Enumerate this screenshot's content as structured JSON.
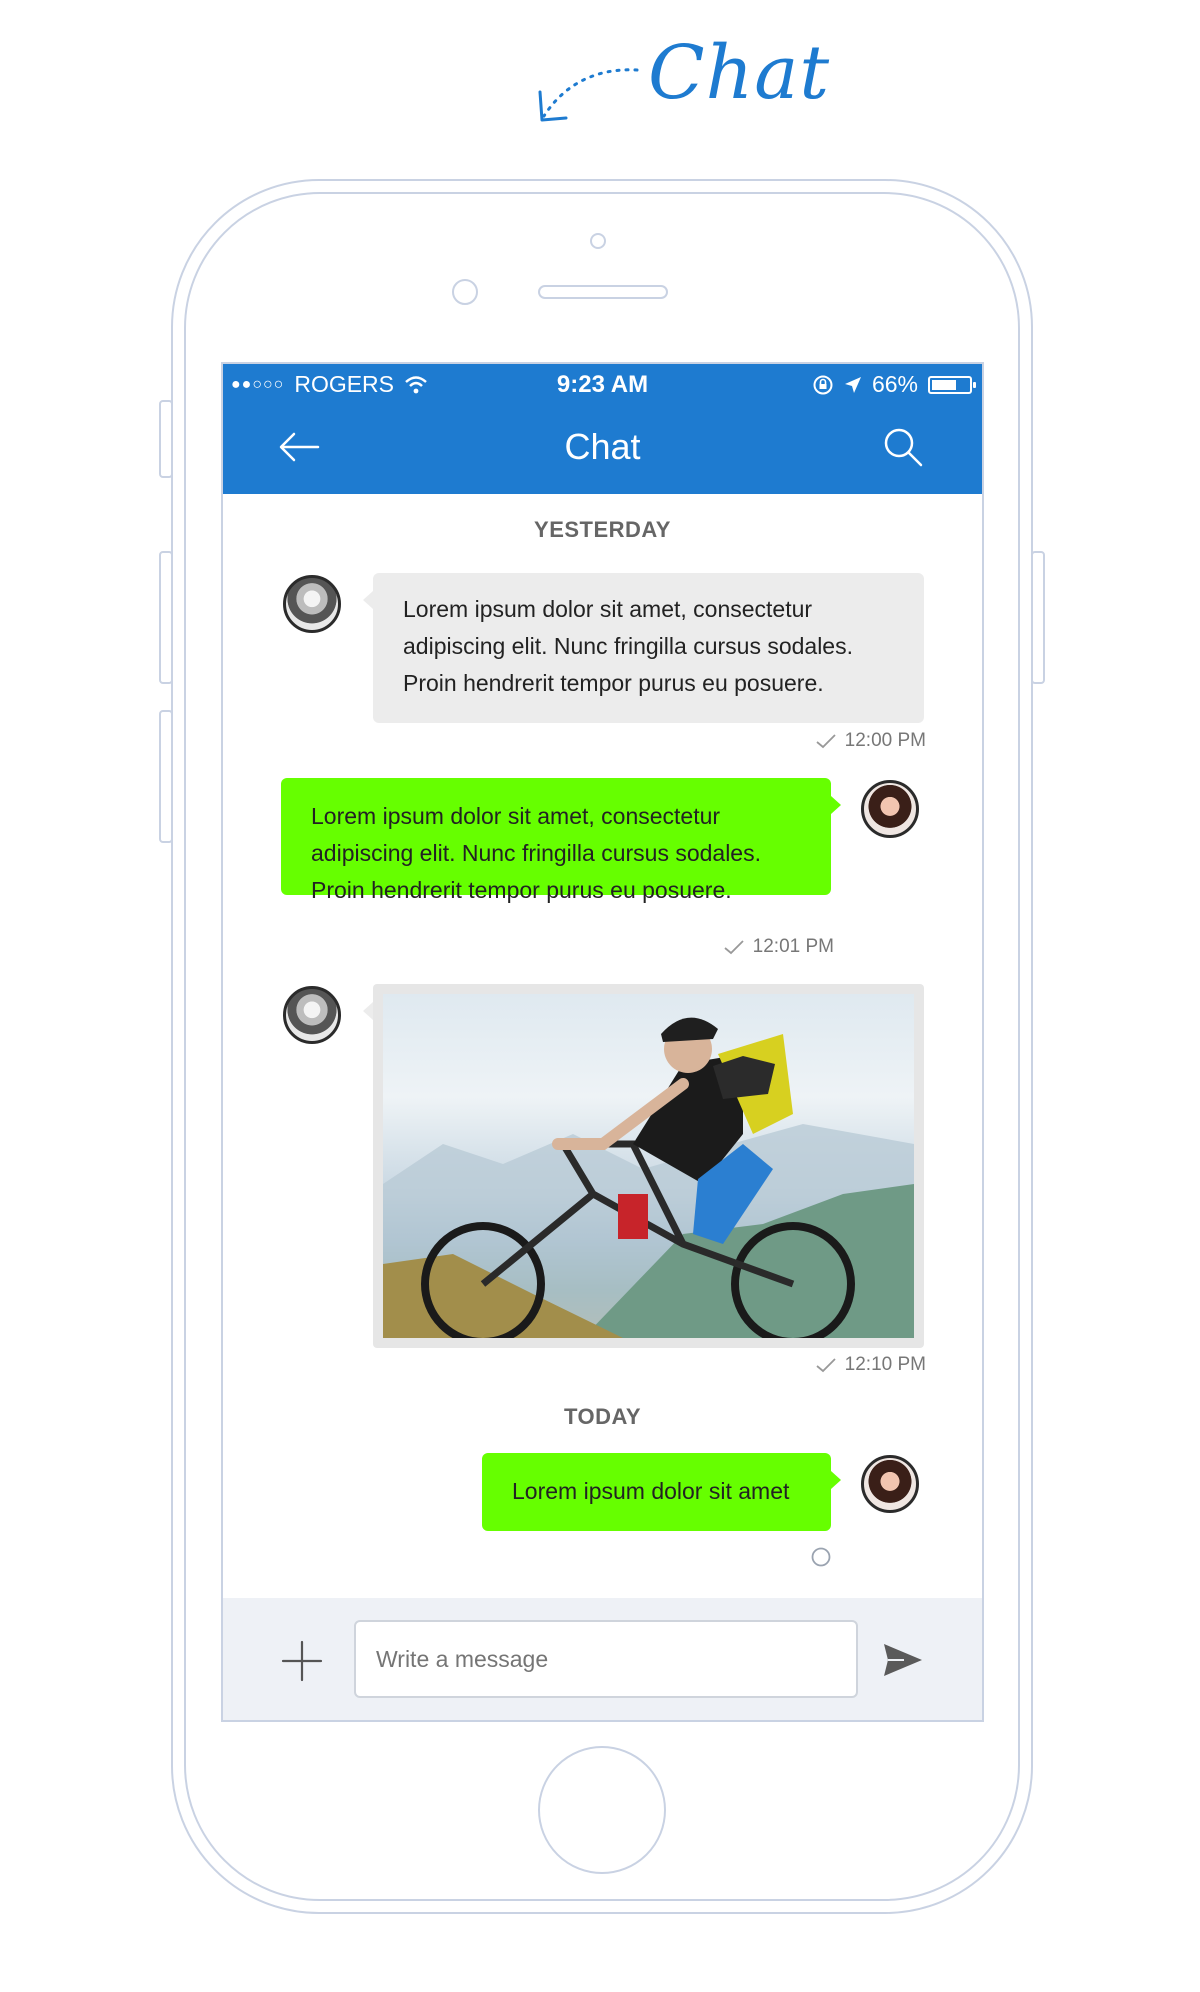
{
  "page": {
    "title": "Chat"
  },
  "status_bar": {
    "carrier": "ROGERS",
    "time": "9:23 AM",
    "battery": "66%",
    "battery_level": 0.66
  },
  "header": {
    "title": "Chat"
  },
  "sections": [
    {
      "label": "YESTERDAY"
    },
    {
      "label": "TODAY"
    }
  ],
  "messages": [
    {
      "lines": [
        "Lorem ipsum dolor sit amet, consectetur",
        "adipiscing elit. Nunc fringilla cursus sodales.",
        "Proin hendrerit tempor purus eu posuere."
      ],
      "time": "12:00 PM"
    },
    {
      "lines": [
        "Lorem ipsum dolor sit amet, consectetur",
        "adipiscing elit. Nunc fringilla cursus sodales.",
        "Proin hendrerit tempor purus eu posuere."
      ],
      "time": "12:01 PM"
    },
    {
      "time": "12:10 PM"
    },
    {
      "text": "Lorem ipsum dolor sit amet"
    }
  ],
  "composer": {
    "placeholder": "Write a message"
  },
  "colors": {
    "primary": "#1e7bd0",
    "outgoing": "#66ff00",
    "incoming": "#ececec"
  }
}
